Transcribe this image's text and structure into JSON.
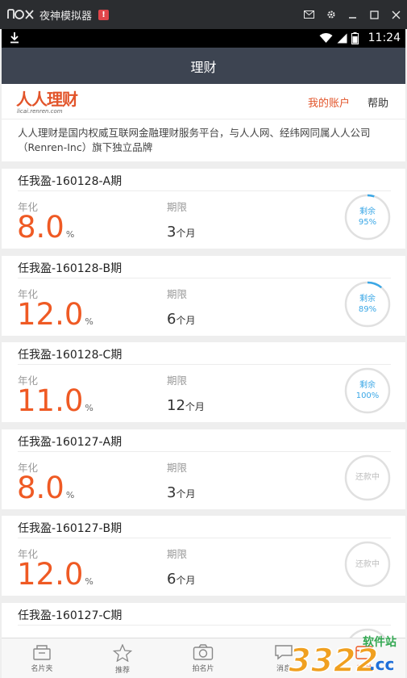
{
  "emulator": {
    "title": "夜神模拟器",
    "warn": "!"
  },
  "status_bar": {
    "time": "11:24"
  },
  "app": {
    "title": "理财"
  },
  "brand": {
    "logo_text": "人人理财",
    "logo_domain": "licai.renren.com",
    "my_account": "我的账户",
    "help": "帮助"
  },
  "intro": {
    "line1": "人人理财是国内权威互联网金融理财服务平台，与人人网、经纬网同属人人公司",
    "line2": "（Renren-Inc）旗下独立品牌"
  },
  "labels": {
    "rate": "年化",
    "term": "期限",
    "pct": "%",
    "month_unit": "个月"
  },
  "products": [
    {
      "name": "任我盈-160128-A期",
      "rate": "8.0",
      "term": "3",
      "status": "剩余",
      "remaining": "95%",
      "remaining_fraction": 0.95,
      "state": "active"
    },
    {
      "name": "任我盈-160128-B期",
      "rate": "12.0",
      "term": "6",
      "status": "剩余",
      "remaining": "89%",
      "remaining_fraction": 0.89,
      "state": "active"
    },
    {
      "name": "任我盈-160128-C期",
      "rate": "11.0",
      "term": "12",
      "status": "剩余",
      "remaining": "100%",
      "remaining_fraction": 1.0,
      "state": "active"
    },
    {
      "name": "任我盈-160127-A期",
      "rate": "8.0",
      "term": "3",
      "status": "还款中",
      "remaining": "",
      "remaining_fraction": 0,
      "state": "done"
    },
    {
      "name": "任我盈-160127-B期",
      "rate": "12.0",
      "term": "6",
      "status": "还款中",
      "remaining": "",
      "remaining_fraction": 0,
      "state": "done"
    },
    {
      "name": "任我盈-160127-C期",
      "rate": "",
      "term": "",
      "status": "",
      "remaining": "",
      "remaining_fraction": 0,
      "state": "done"
    }
  ],
  "bottom_nav": [
    {
      "label": "名片夹",
      "icon": "card-holder-icon"
    },
    {
      "label": "推荐",
      "icon": "star-icon"
    },
    {
      "label": "拍名片",
      "icon": "camera-icon"
    },
    {
      "label": "消息",
      "icon": "message-icon"
    },
    {
      "label": "理财",
      "icon": "wallet-icon"
    }
  ],
  "watermark": {
    "text": "软件站",
    "number": "3322",
    "tld": ".cc"
  },
  "colors": {
    "accent": "#ef5a24",
    "ring_active": "#3aa7e6",
    "ring_track": "#e0e0e0",
    "header": "#3d4451"
  }
}
